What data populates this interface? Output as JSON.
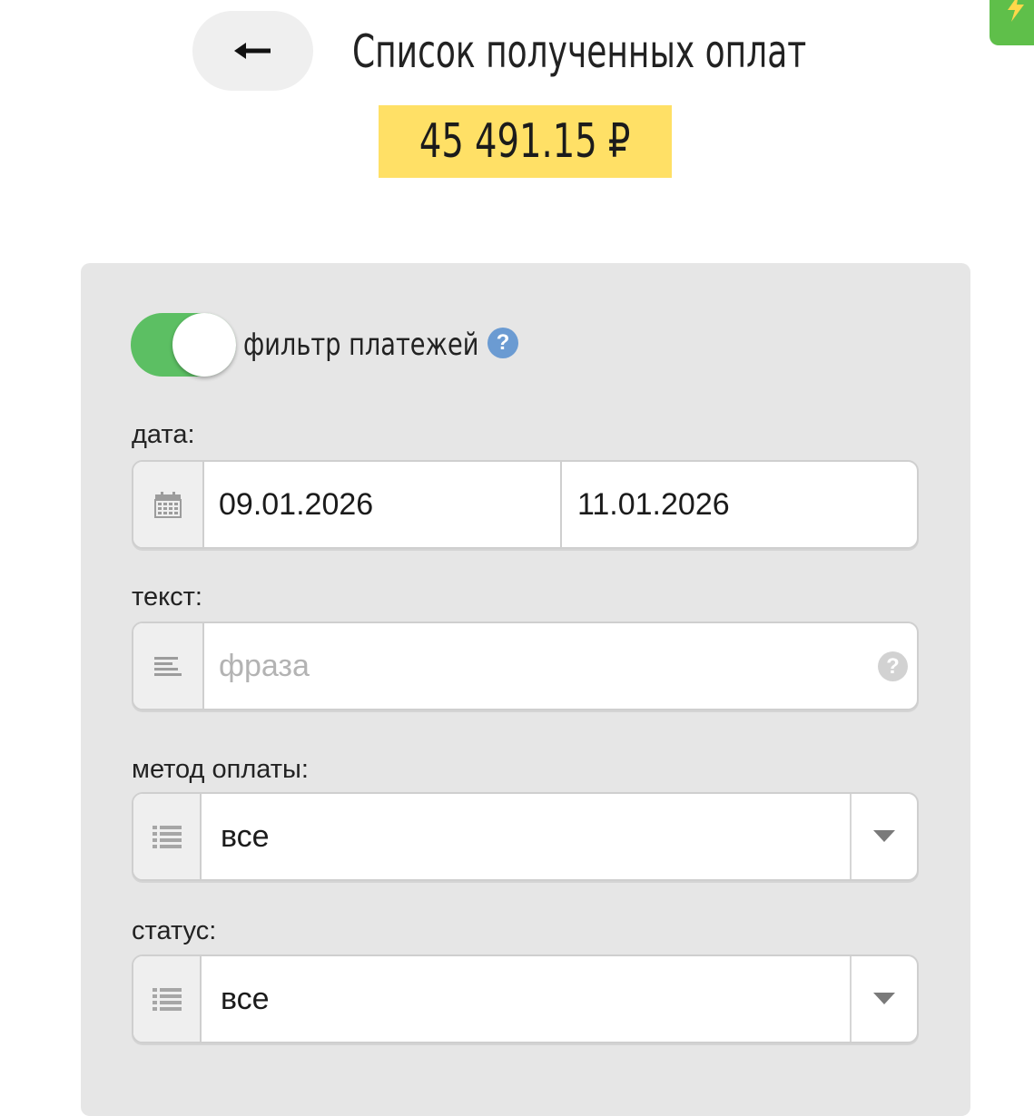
{
  "header": {
    "back_glyph": "←",
    "title": "Список полученных оплат",
    "total_amount": "45 491.15 ₽"
  },
  "filter": {
    "toggle_on": true,
    "toggle_label": "фильтр платежей",
    "help_glyph": "?",
    "date": {
      "label": "дата:",
      "from": "09.01.2026",
      "to": "11.01.2026"
    },
    "text": {
      "label": "текст:",
      "value": "",
      "placeholder": "фраза",
      "help_glyph": "?"
    },
    "payment_method": {
      "label": "метод оплаты:",
      "selected": "все"
    },
    "status": {
      "label": "статус:",
      "selected": "все"
    }
  },
  "colors": {
    "total_badge_bg": "#ffe066",
    "toggle_on": "#5cbf63",
    "help_icon": "#6b9bd2",
    "panel_bg": "#e6e6e6",
    "corner_badge": "#5fbf4a"
  },
  "icons": {
    "back": "arrow-left-icon",
    "date": "calendar-icon",
    "text": "text-lines-icon",
    "payment_method": "list-icon",
    "status": "list-icon",
    "dropdown": "caret-down-icon",
    "help": "question-circle-icon",
    "corner": "lightning-icon"
  }
}
